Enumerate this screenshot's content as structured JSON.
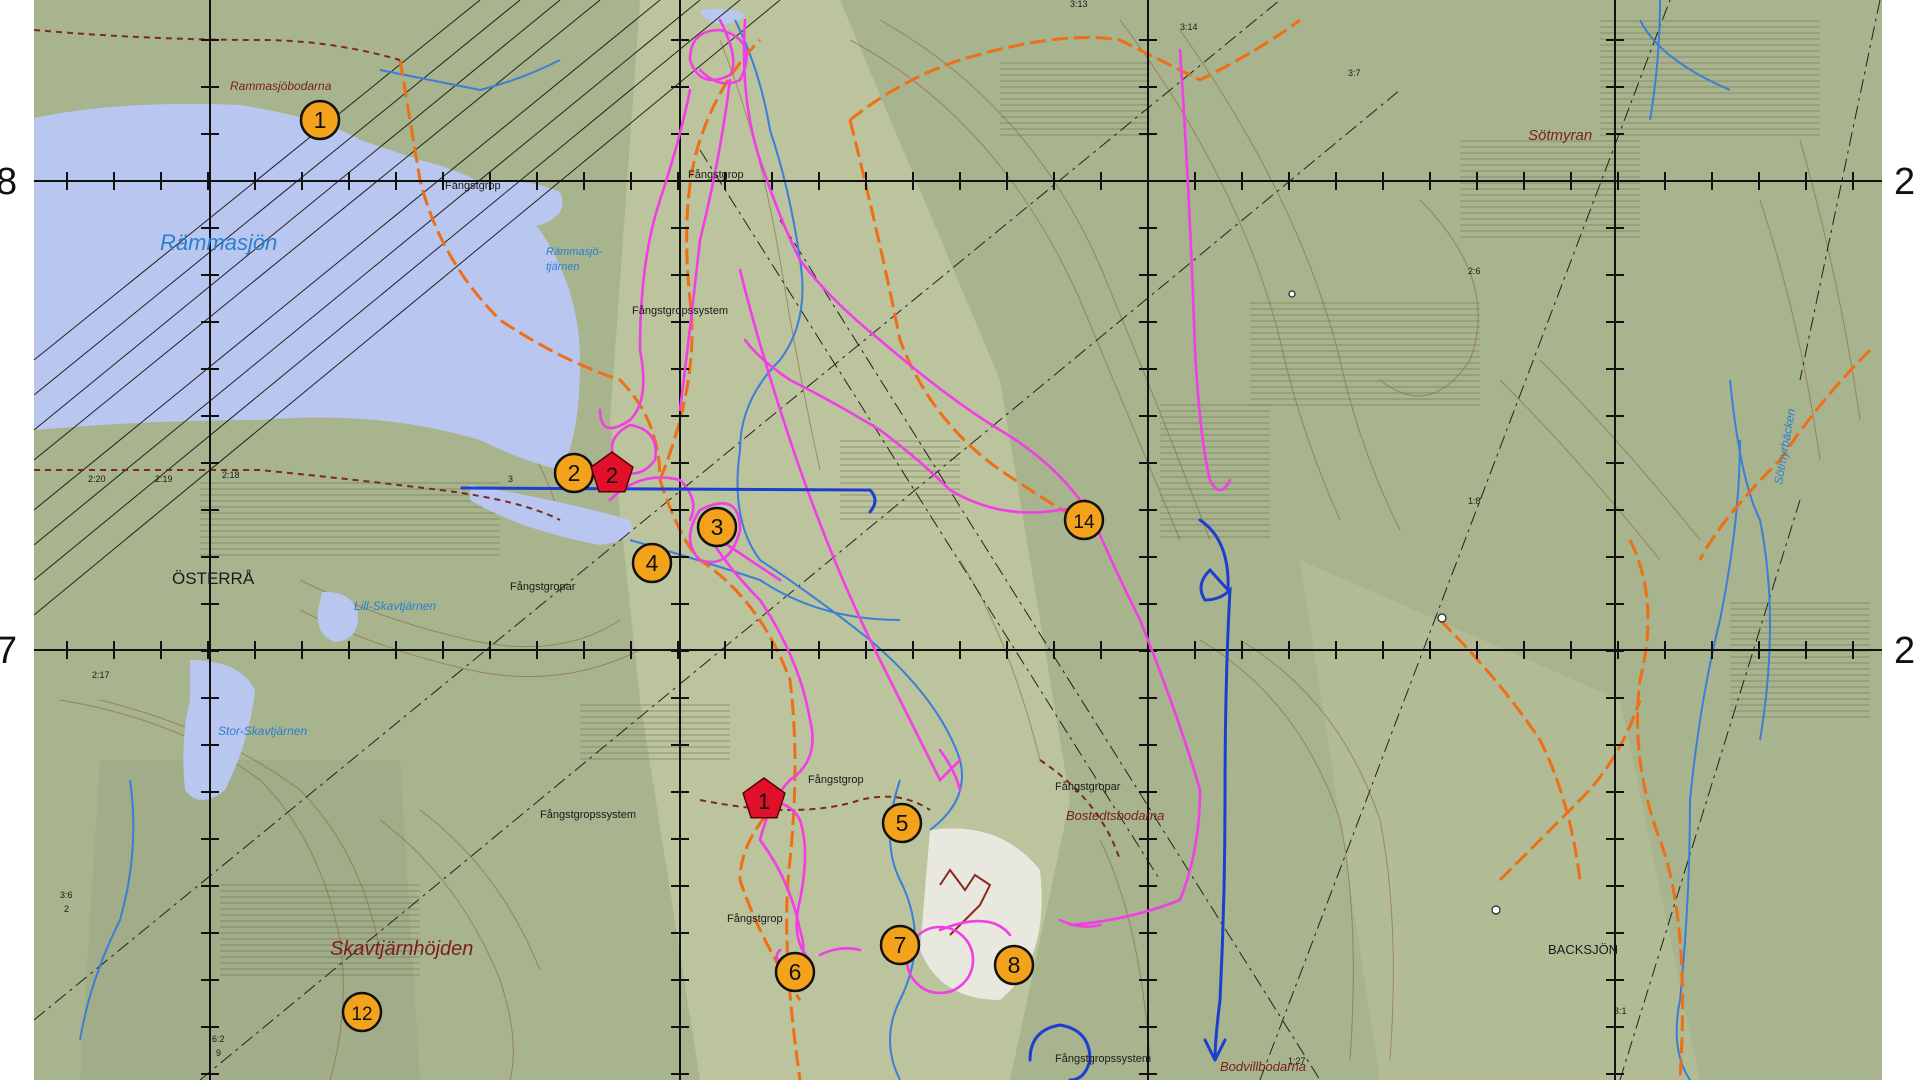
{
  "colors": {
    "land": "#a7b48d",
    "lake": "#b9c6ef",
    "marker_fill": "#f3a21b",
    "start_fill": "#e0102a",
    "track_pink": "#f23ee6",
    "track_blue": "#1c3fd0",
    "trail_orange": "#ee6f16",
    "stream": "#3b7ed8",
    "grid": "#111111"
  },
  "lakes": {
    "rammasjon": "Rämmasjön",
    "rammasjotjarnen_1": "Rämmasjö-",
    "rammasjotjarnen_2": "tjärnen",
    "lill_skavtjarnen": "Lill-Skavtjärnen",
    "stor_skavtjarnen": "Stor-Skavtjärnen",
    "sotmyrbacken": "Sötmyrbäcken"
  },
  "places": {
    "rammasjobodarna": "Rammasjöbodarna",
    "sotmyran": "Sötmyran",
    "osterra": "ÖSTERRÅ",
    "skavtjarnhojden": "Skavtjärnhöjden",
    "bostedtsbodarna": "Bostedtsbodarna",
    "backsjon": "BACKSJÖN",
    "bodvillbodarna": "Bodvillbodarna"
  },
  "features": {
    "fangstgrop_a": "Fångstgrop",
    "fangstgrop_b": "Fångstgrop",
    "fangstgrop_c": "Fångstgrop",
    "fangstgrop_d": "Fångstgrop",
    "fangstgropssystem_a": "Fångstgropssystem",
    "fangstgropssystem_b": "Fångstgropssystem",
    "fangstgropssystem_c": "Fångstgropssystem",
    "fangstgropar_a": "Fångstgropar",
    "fangstgropar_b": "Fångstgropar"
  },
  "small_labels": {
    "s313": "3:13",
    "s314": "3:14",
    "s37": "3:7",
    "s26": "2:6",
    "s18": "1:8",
    "s220": "2:20",
    "s219": "2:19",
    "s218": "2:18",
    "s3": "3",
    "s217": "2:17",
    "s36": "3:6",
    "s2": "2",
    "s62": "6:2",
    "s9": "9",
    "s31": "3:1",
    "s127": "1:27"
  },
  "edge_labels": {
    "left_top": "8",
    "left_bottom": "7",
    "right_top": "2",
    "right_bottom": "2"
  },
  "markers": [
    {
      "id": "1",
      "label": "1"
    },
    {
      "id": "2",
      "label": "2"
    },
    {
      "id": "3",
      "label": "3"
    },
    {
      "id": "4",
      "label": "4"
    },
    {
      "id": "5",
      "label": "5"
    },
    {
      "id": "6",
      "label": "6"
    },
    {
      "id": "7",
      "label": "7"
    },
    {
      "id": "8",
      "label": "8"
    },
    {
      "id": "12",
      "label": "12"
    },
    {
      "id": "14",
      "label": "14"
    }
  ],
  "start_markers": [
    {
      "id": "1",
      "label": "1"
    },
    {
      "id": "2",
      "label": "2"
    }
  ]
}
